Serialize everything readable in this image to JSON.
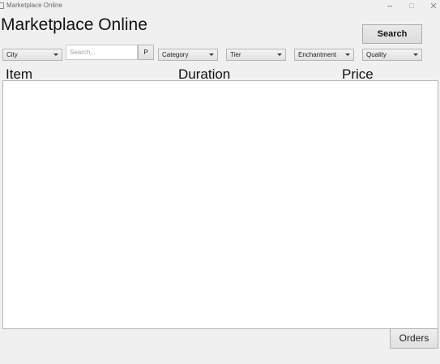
{
  "window": {
    "title": "Marketplace Online",
    "icon": "app-icon",
    "controls": {
      "minimize_icon": "minimize-icon",
      "maximize_icon": "maximize-icon",
      "close_icon": "close-icon"
    }
  },
  "header": {
    "title": "Marketplace Online",
    "search_button": "Search"
  },
  "filters": {
    "city": "City",
    "search_placeholder": "Search...",
    "search_value": "",
    "p_button": "P",
    "category": "Category",
    "tier": "Tier",
    "enchantment": "Enchantment",
    "quality": "Quality",
    "dropdown_icon": "chevron-down-icon"
  },
  "table": {
    "columns": [
      "Item",
      "Duration",
      "Price"
    ],
    "rows": []
  },
  "footer": {
    "orders_button": "Orders"
  }
}
